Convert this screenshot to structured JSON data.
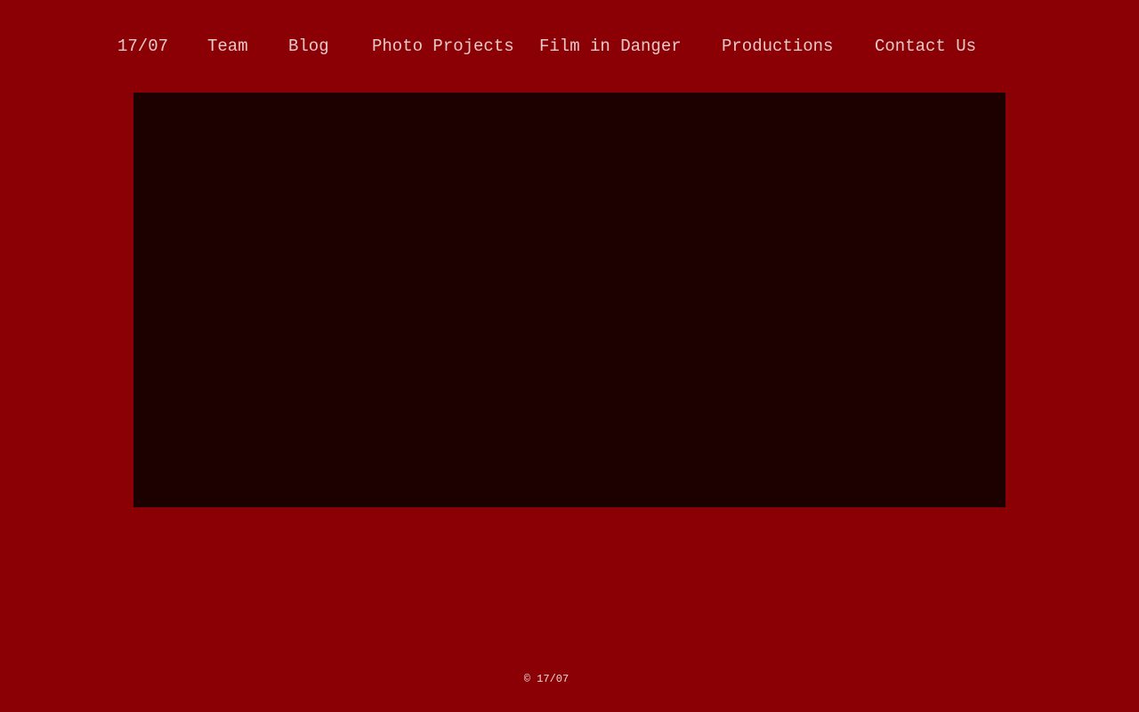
{
  "nav": {
    "home": "17/07",
    "team": "Team",
    "blog": "Blog",
    "photo_projects": "Photo Projects",
    "film_in_danger": "Film in Danger",
    "productions": "Productions",
    "contact": "Contact Us"
  },
  "footer": {
    "copyright": "© 17/07"
  },
  "colors": {
    "background": "#8b0004",
    "hero": "#1d0000",
    "nav_text": "#e8c9c9"
  }
}
